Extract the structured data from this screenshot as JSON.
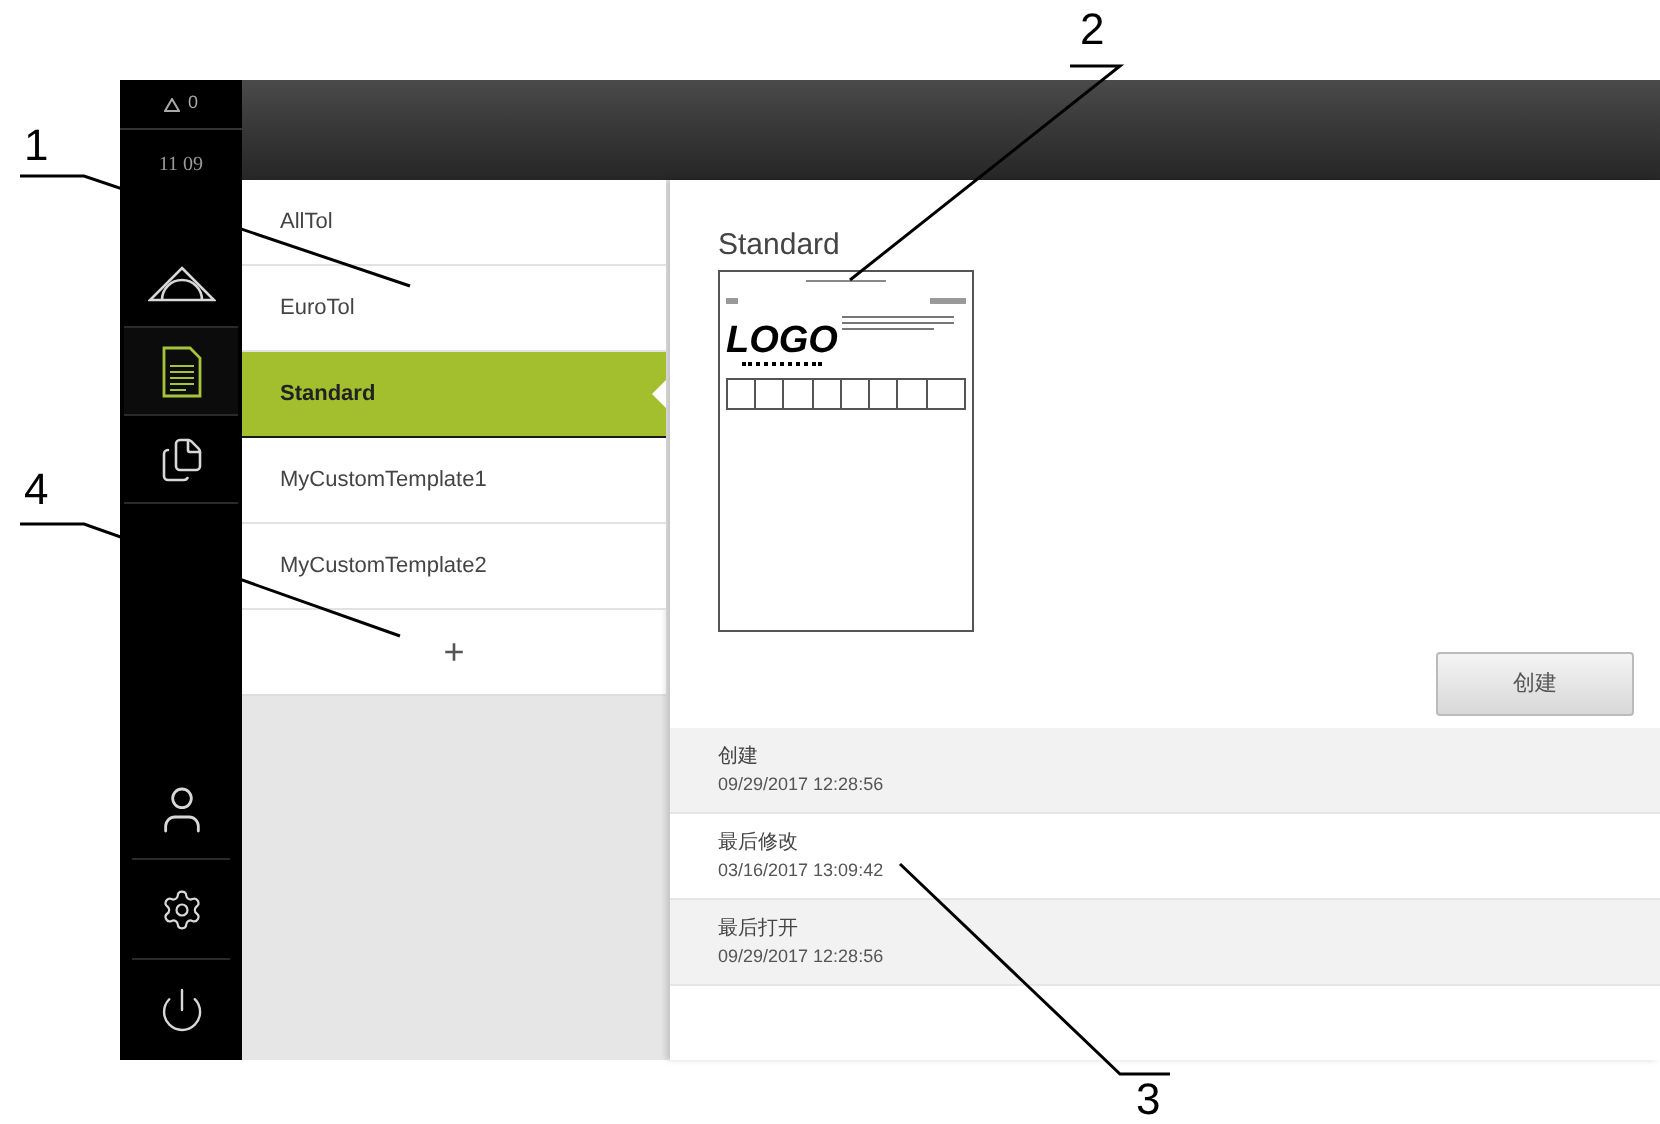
{
  "status": {
    "warnings": "0",
    "time": "11 09"
  },
  "sidebar": {
    "items": [
      {
        "kind": "measure",
        "selected": false
      },
      {
        "kind": "report",
        "selected": true
      },
      {
        "kind": "files",
        "selected": false
      }
    ],
    "bottom": [
      {
        "kind": "user"
      },
      {
        "kind": "settings"
      },
      {
        "kind": "power"
      }
    ]
  },
  "templates": [
    {
      "label": "AllTol",
      "selected": false
    },
    {
      "label": "EuroTol",
      "selected": false
    },
    {
      "label": "Standard",
      "selected": true
    },
    {
      "label": "MyCustomTemplate1",
      "selected": false
    },
    {
      "label": "MyCustomTemplate2",
      "selected": false
    }
  ],
  "add_button": {
    "label": "+"
  },
  "detail": {
    "title": "Standard",
    "preview": {
      "logo": "LOGO"
    },
    "create_button": "创建",
    "properties": [
      {
        "label": "创建",
        "value": "09/29/2017 12:28:56"
      },
      {
        "label": "最后修改",
        "value": "03/16/2017 13:09:42"
      },
      {
        "label": "最后打开",
        "value": "09/29/2017 12:28:56"
      }
    ]
  },
  "callouts": [
    {
      "label": "1"
    },
    {
      "label": "2"
    },
    {
      "label": "3"
    },
    {
      "label": "4"
    }
  ]
}
